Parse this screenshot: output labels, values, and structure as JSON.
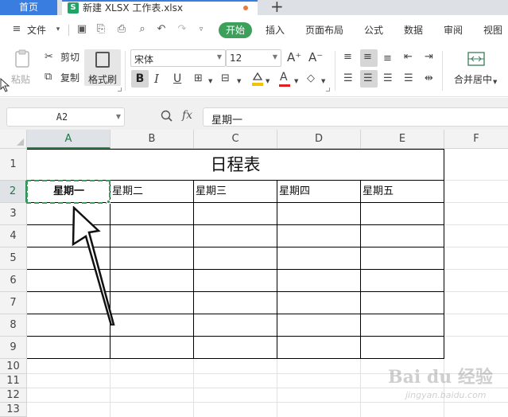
{
  "tabs": {
    "home_label": "首页",
    "doc_icon": "S",
    "doc_label": "新建 XLSX 工作表.xlsx",
    "add_label": "+"
  },
  "menu": {
    "file_label": "文件",
    "tabs": [
      "开始",
      "插入",
      "页面布局",
      "公式",
      "数据",
      "审阅",
      "视图"
    ]
  },
  "ribbon": {
    "paste_label": "粘贴",
    "cut_label": "剪切",
    "copy_label": "复制",
    "format_painter_label": "格式刷",
    "font_name": "宋体",
    "font_size": "12",
    "bold_label": "B",
    "italic_label": "I",
    "underline_label": "U",
    "merge_label": "合并居中",
    "font_grow": "A⁺",
    "font_shrink": "A⁻",
    "font_color_label": "A"
  },
  "formula_bar": {
    "name_box": "A2",
    "fx_label": "fx",
    "formula": "星期一"
  },
  "grid": {
    "columns": [
      "A",
      "B",
      "C",
      "D",
      "E",
      "F"
    ],
    "rows": [
      "1",
      "2",
      "3",
      "4",
      "5",
      "6",
      "7",
      "8",
      "9",
      "10",
      "11",
      "12",
      "13"
    ],
    "title": "日程表",
    "days": [
      "星期一",
      "星期二",
      "星期三",
      "星期四",
      "星期五"
    ],
    "selected_cell": "A2",
    "selection_color": "#3d9b5b"
  },
  "watermark": {
    "brand": "Bai du 经验",
    "site": "jingyan.baidu.com"
  },
  "annotation": {
    "arrow_target": "A2"
  }
}
